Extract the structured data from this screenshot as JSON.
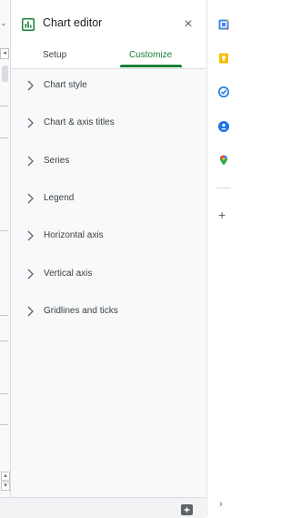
{
  "editor": {
    "title": "Chart editor",
    "tabs": [
      {
        "label": "Setup",
        "active": false
      },
      {
        "label": "Customize",
        "active": true
      }
    ],
    "sections": [
      {
        "label": "Chart style"
      },
      {
        "label": "Chart & axis titles"
      },
      {
        "label": "Series"
      },
      {
        "label": "Legend"
      },
      {
        "label": "Horizontal axis"
      },
      {
        "label": "Vertical axis"
      },
      {
        "label": "Gridlines and ticks"
      }
    ]
  },
  "colors": {
    "accent_green": "#188038",
    "panel_bg": "#f8f9fa",
    "text": "#3c4043"
  },
  "side_panel": {
    "icons": [
      "calendar-icon",
      "keep-icon",
      "tasks-icon",
      "contacts-icon",
      "maps-icon",
      "add-icon",
      "collapse-icon"
    ]
  }
}
